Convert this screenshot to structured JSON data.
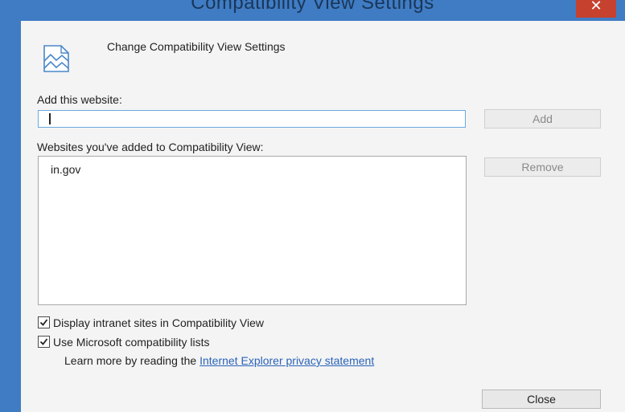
{
  "window": {
    "title": "Compatibility View Settings",
    "close_glyph": "✕"
  },
  "header": {
    "icon": "compatibility-view-icon",
    "text": "Change Compatibility View Settings"
  },
  "add_website": {
    "label": "Add this website:",
    "value": "",
    "button": "Add"
  },
  "websites": {
    "label": "Websites you've added to Compatibility View:",
    "items": [
      "in.gov"
    ],
    "remove_button": "Remove"
  },
  "options": {
    "intranet": {
      "label": "Display intranet sites in Compatibility View",
      "checked": true
    },
    "microsoft_lists": {
      "label": "Use Microsoft compatibility lists",
      "checked": true
    },
    "learn_more_prefix": "Learn more by reading the",
    "learn_more_link": "Internet Explorer privacy statement"
  },
  "footer": {
    "close_button": "Close"
  },
  "colors": {
    "frame": "#3f7cc4",
    "close": "#c7412f",
    "link": "#2a63b8",
    "input_border": "#6aa9e0"
  }
}
